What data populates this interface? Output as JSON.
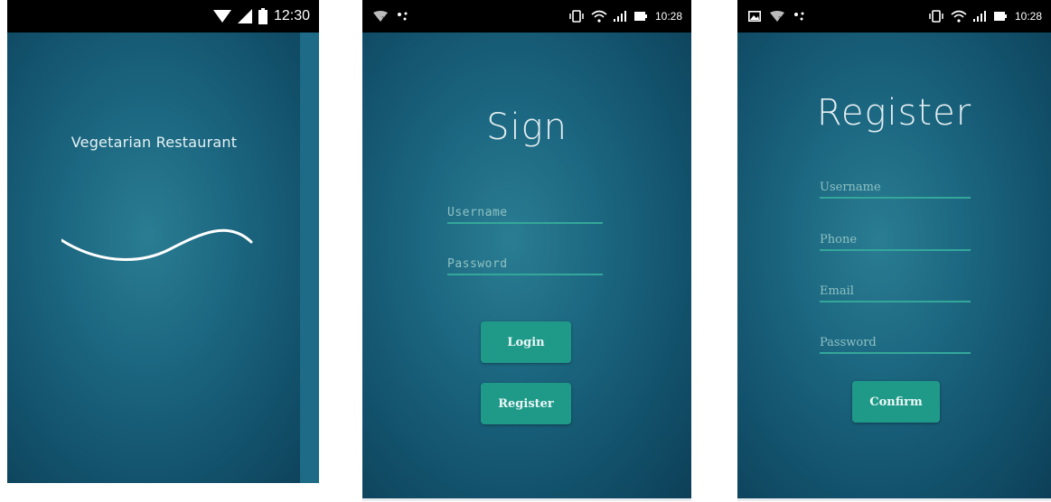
{
  "screens": {
    "splash": {
      "status": {
        "time": "12:30",
        "icons": [
          "wifi-icon",
          "signal-icon",
          "battery-icon"
        ]
      },
      "app_name": "Vegetarian Restaurant",
      "loader_icon": "wave-line-icon"
    },
    "sign": {
      "status": {
        "time": "10:28",
        "left_icons": [
          "wifi-question-icon",
          "signal-dots-icon"
        ],
        "right_icons": [
          "vibrate-icon",
          "wifi-icon",
          "signal-bars-icon",
          "battery-charging-icon"
        ]
      },
      "title": "Sign",
      "username_placeholder": "Username",
      "password_placeholder": "Password",
      "login_label": "Login",
      "register_label": "Register"
    },
    "register": {
      "status": {
        "time": "10:28",
        "left_icons": [
          "image-notification-icon",
          "wifi-question-icon",
          "signal-dots-icon"
        ],
        "right_icons": [
          "vibrate-icon",
          "wifi-icon",
          "signal-bars-icon",
          "battery-charging-icon"
        ]
      },
      "title": "Register",
      "username_placeholder": "Username",
      "phone_placeholder": "Phone",
      "email_placeholder": "Email",
      "password_placeholder": "Password",
      "confirm_label": "Confirm"
    }
  },
  "colors": {
    "accent": "#1f9a89",
    "field_underline": "#34a79a",
    "background_center": "#2a7d92",
    "background_edge": "#0d3f57",
    "status_bar": "#000000"
  }
}
